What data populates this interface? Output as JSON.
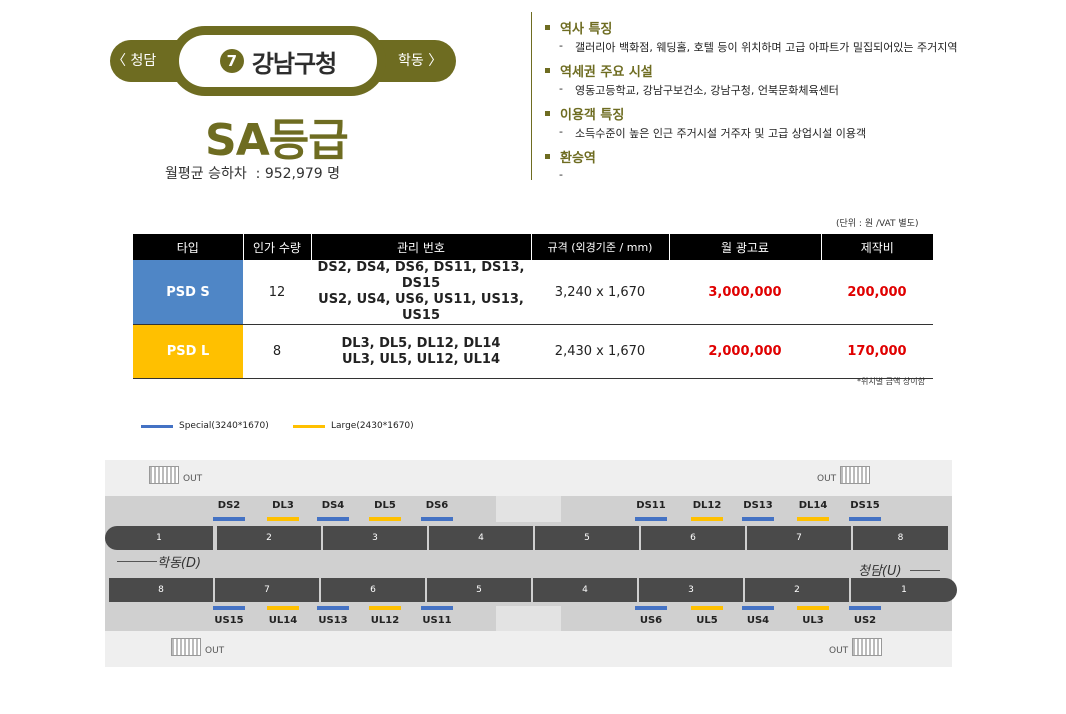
{
  "station": {
    "number": "7",
    "name": "강남구청",
    "prev": "〈 청담",
    "next": "학동 〉",
    "grade": "SA등급",
    "traffic_label": "월평균 승하차",
    "traffic_value": "952,979",
    "traffic_unit": "명"
  },
  "info": [
    {
      "title": "역사 특징",
      "body": "갤러리아 백화점, 웨딩홀, 호텔 등이 위치하며 고급 아파트가 밀집되어있는 주거지역"
    },
    {
      "title": "역세권 주요 시설",
      "body": "영동고등학교, 강남구보건소, 강남구청, 언북문화체육센터"
    },
    {
      "title": "이용객 특징",
      "body": "소득수준이 높은 인근 주거시설 거주자 및 고급 상업시설 이용객"
    },
    {
      "title": "환승역",
      "body": ""
    }
  ],
  "table": {
    "unit_note": "(단위 : 원 /VAT 별도)",
    "headers": [
      "타입",
      "인가 수량",
      "관리 번호",
      "규격 (외경기준 / mm)",
      "월 광고료",
      "제작비"
    ],
    "rows": [
      {
        "type": "PSD S",
        "qty": "12",
        "codes1": "DS2, DS4, DS6, DS11, DS13, DS15",
        "codes2": "US2, US4, US6, US11, US13, US15",
        "size": "3,240 x 1,670",
        "monthly": "3,000,000",
        "production": "200,000"
      },
      {
        "type": "PSD L",
        "qty": "8",
        "codes1": "DL3, DL5, DL12, DL14",
        "codes2": "UL3, UL5, UL12, UL14",
        "size": "2,430 x 1,670",
        "monthly": "2,000,000",
        "production": "170,000"
      }
    ],
    "footnote": "*위치별 금액 상이함"
  },
  "legend": {
    "special": "Special(3240*1670)",
    "large": "Large(2430*1670)",
    "special_color": "#4472c4",
    "large_color": "#ffc000"
  },
  "diagram": {
    "out_label": "OUT",
    "dir_down": "학동(D)",
    "dir_up": "청담(U)",
    "top_cars": [
      "1",
      "2",
      "3",
      "4",
      "5",
      "6",
      "7",
      "8"
    ],
    "bottom_cars": [
      "8",
      "7",
      "6",
      "5",
      "4",
      "3",
      "2",
      "1"
    ],
    "top_doors": [
      "DS2",
      "DL3",
      "DS4",
      "DL5",
      "DS6",
      "DS11",
      "DL12",
      "DS13",
      "DL14",
      "DS15"
    ],
    "bottom_doors": [
      "US15",
      "UL14",
      "US13",
      "UL12",
      "US11",
      "US6",
      "UL5",
      "US4",
      "UL3",
      "US2"
    ]
  }
}
